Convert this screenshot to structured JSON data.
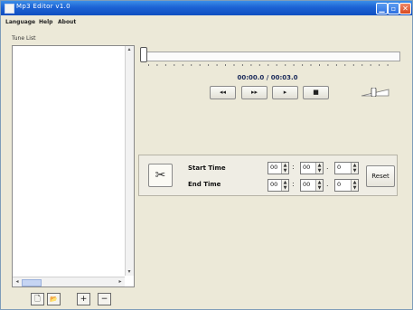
{
  "window": {
    "title": "Mp3 Editor v1.0"
  },
  "titlebar_buttons": {
    "minimize": "▁",
    "maximize": "▫",
    "close": "✕"
  },
  "menu": [
    "Language",
    "Help",
    "About"
  ],
  "tune_list": {
    "label": "Tune List",
    "items": []
  },
  "list_buttons": {
    "new": "🗋",
    "open": "📂",
    "add": "+",
    "remove": "−"
  },
  "player": {
    "position": "00:00.0",
    "separator": "/",
    "duration": "00:03.0",
    "seek_fraction": 0.0,
    "controls": {
      "rewind": "◂◂",
      "forward": "▸▸",
      "play": "▸",
      "stop": "■"
    }
  },
  "trim": {
    "start_label": "Start Time",
    "end_label": "End Time",
    "start": {
      "min": "00",
      "sec": "00",
      "tenth": "0"
    },
    "end": {
      "min": "00",
      "sec": "00",
      "tenth": "0"
    },
    "colon": ":",
    "dot": ".",
    "reset_label": "Reset",
    "cut_icon": "✂"
  },
  "colors": {
    "titlebar": "#1c62d4",
    "window": "#ece9d8",
    "time_text": "#1a2a5a"
  }
}
